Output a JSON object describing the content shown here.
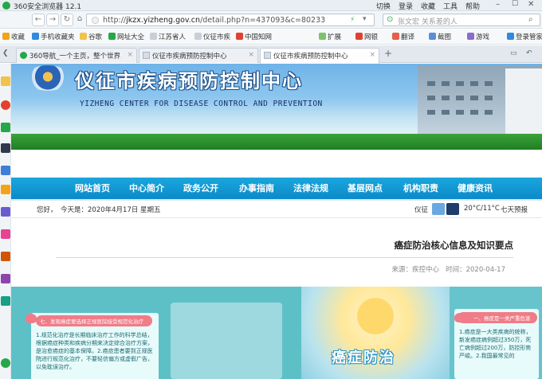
{
  "browser": {
    "app_title": "360安全浏览器 12.1",
    "menu": [
      "切换",
      "登录",
      "收藏",
      "工具",
      "帮助"
    ],
    "url_prefix": "http://",
    "url_host": "jkzx.yizheng.gov.cn",
    "url_path": "/detail.php?n=437093&c=80233",
    "search_placeholder": "张文宏 关系差的人",
    "bookmarks": [
      {
        "label": "收藏",
        "icon": "star-icon",
        "color": "#f2a31b"
      },
      {
        "label": "手机收藏夹",
        "icon": "phone-icon",
        "color": "#2d8be0"
      },
      {
        "label": "谷歌",
        "icon": "folder-icon",
        "color": "#f2c24c"
      },
      {
        "label": "网址大全",
        "icon": "globe-icon",
        "color": "#25a848"
      },
      {
        "label": "江苏省人",
        "icon": "doc-icon",
        "color": "#c9cfd6"
      },
      {
        "label": "仪征市疾",
        "icon": "doc-icon",
        "color": "#c9cfd6"
      },
      {
        "label": "中国知网",
        "icon": "cnki-icon",
        "color": "#e0422f"
      }
    ],
    "toolbar_right": [
      "扩展",
      "网银",
      "翻译",
      "截图",
      "游戏",
      "登录管家"
    ],
    "tabs": [
      {
        "label": "360导航_一个主页，整个世界",
        "active": false
      },
      {
        "label": "仪征市疾病预防控制中心",
        "active": false
      },
      {
        "label": "仪征市疾病预防控制中心",
        "active": true
      }
    ]
  },
  "site": {
    "name_cn": "仪征市疾病预防控制中心",
    "name_en": "YIZHENG CENTER FOR DISEASE CONTROL AND PREVENTION",
    "nav": [
      "网站首页",
      "中心简介",
      "政务公开",
      "办事指南",
      "法律法规",
      "基层网点",
      "机构职责",
      "健康资讯"
    ],
    "greeting": "您好，",
    "date_text": "今天是：2020年4月17日  星期五",
    "weather_city": "仪征",
    "weather_temp": "20°C/11°C",
    "weather_link": "七天预报"
  },
  "article": {
    "title": "癌症防治核心信息及知识要点",
    "source": "来源：疾控中心",
    "time": "时间：2020-04-17",
    "image1_header": "七、发现癌症要选择正规医院接受规范化治疗",
    "image1_body": "1.规范化治疗是长期临床治疗工作的科学总结，根据癌症种类和疾病分期来决定综合治疗方案，是治愈癌症的基本保障。2.癌症患者要到正规医院进行规范化治疗，不要轻信偏方或虚假广告，以免耽误治疗。",
    "image2_caption": "癌症防治",
    "image3_header": "一、癌症是一类严重危害",
    "image3_body": "1.癌症是一大类疾病的统称，新发癌症病例超过350万，死亡病例超过200万，防控形势严峻。2.我国最常见的"
  }
}
